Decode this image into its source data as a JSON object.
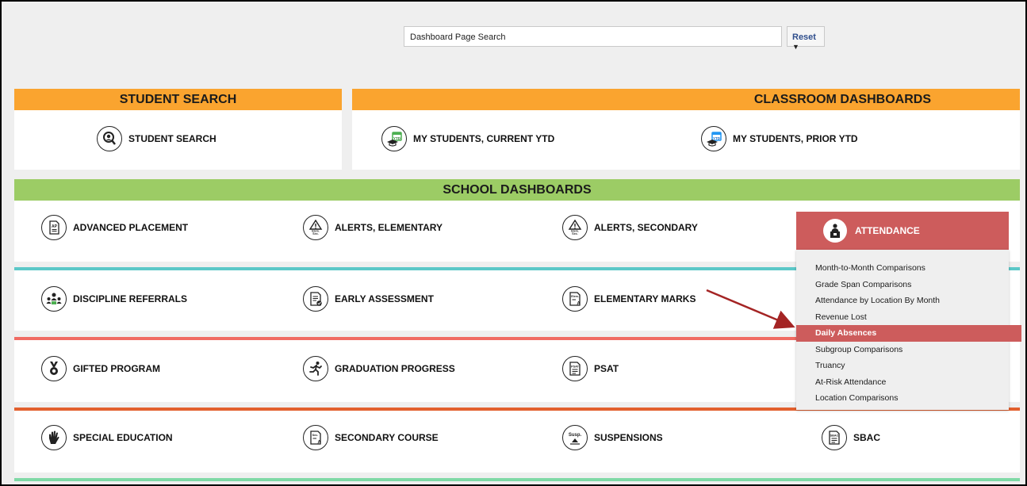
{
  "topbar": {
    "search_value": "Dashboard Page Search",
    "reset_label": "Reset"
  },
  "student_search": {
    "header": "STUDENT SEARCH",
    "item": "STUDENT SEARCH"
  },
  "classroom": {
    "header": "CLASSROOM DASHBOARDS",
    "items": [
      "MY STUDENTS, CURRENT YTD",
      "MY STUDENTS, PRIOR YTD"
    ]
  },
  "school": {
    "header": "SCHOOL DASHBOARDS",
    "row1": [
      "ADVANCED PLACEMENT",
      "ALERTS, ELEMENTARY",
      "ALERTS, SECONDARY"
    ],
    "row2": [
      "DISCIPLINE REFERRALS",
      "EARLY ASSESSMENT",
      "ELEMENTARY MARKS"
    ],
    "row3": [
      "GIFTED PROGRAM",
      "GRADUATION PROGRESS",
      "PSAT"
    ],
    "row4": [
      "SPECIAL EDUCATION",
      "SECONDARY COURSE",
      "SUSPENSIONS",
      "SBAC"
    ]
  },
  "attendance": {
    "title": "ATTENDANCE",
    "menu": [
      "Month-to-Month Comparisons",
      "Grade Span Comparisons",
      "Attendance by Location By Month",
      "Revenue Lost",
      "Daily Absences",
      "Subgroup Comparisons",
      "Truancy",
      "At-Risk Attendance",
      "Location Comparisons"
    ],
    "selected": "Daily Absences"
  },
  "colors": {
    "orange": "#faa42f",
    "green": "#9ccc65",
    "teal": "#5bc8c8",
    "salmon": "#f06b63",
    "deep_orange": "#e2602e",
    "mint": "#7fd9a6",
    "attendance_red": "#cd5c5c",
    "arrow": "#a42424"
  },
  "icons": {
    "student_search": "magnifier-person-icon",
    "ytd_current": "ytd-calendar-icon",
    "ytd_prior": "ytd-calendar-icon",
    "ap": "ap-document-icon",
    "alerts": "warning-icon",
    "attendance": "teacher-icon",
    "discipline": "group-icon",
    "early_assessment": "clipboard-check-icon",
    "marks": "grade-document-icon",
    "gifted": "medal-icon",
    "graduation": "runner-icon",
    "psat": "psat-document-icon",
    "sped": "hand-icon",
    "secondary_course": "secondary-document-icon",
    "suspensions": "susp-icon",
    "sbac": "sbac-document-icon"
  }
}
